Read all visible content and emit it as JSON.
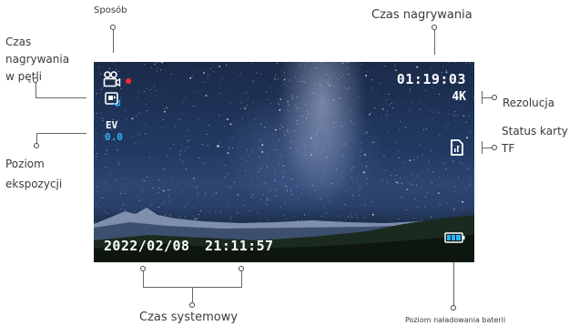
{
  "labels": {
    "mode": "Sposób",
    "record_time": "Czas nagrywania",
    "loop_line1": "Czas",
    "loop_line2": "nagrywania",
    "loop_line3": "w pętli",
    "resolution": "Rezolucja",
    "card_line1": "Status karty",
    "card_line2": "TF",
    "exposure_line1": "Poziom",
    "exposure_line2": "ekspozycji",
    "system_time": "Czas systemowy",
    "battery": "Poziom naładowania baterii"
  },
  "screen": {
    "record_time": "01:19:03",
    "resolution": "4K",
    "ev_label": "EV",
    "ev_value": "0.0",
    "date": "2022/02/08",
    "time": "21:11:57"
  },
  "icons": {
    "mode": "video-camera-icon",
    "recording": "recording-dot-icon",
    "loop": "loop-recording-icon",
    "tf_card": "sd-card-icon",
    "battery": "battery-icon"
  },
  "colors": {
    "rec_dot": "#ff2a2a",
    "ev_value": "#2bb3ff",
    "battery_fill": "#2bb3ff"
  }
}
